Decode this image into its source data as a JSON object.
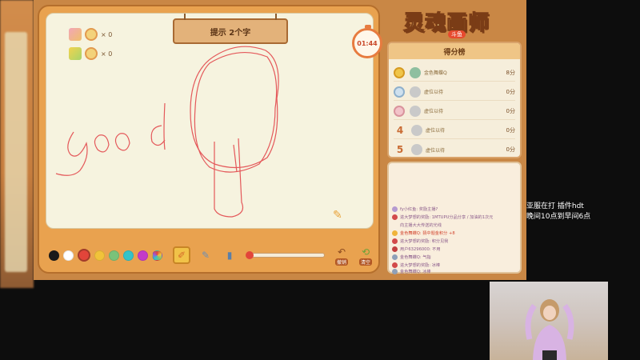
{
  "game": {
    "hint": "提示 2个字",
    "timer": "01:44",
    "props": [
      {
        "icon": "flower-icon",
        "count": "× 0"
      },
      {
        "icon": "egg-icon",
        "count": "× 0"
      }
    ],
    "drawing": {
      "word_written": "good"
    },
    "palette": [
      "#1a1a1a",
      "#ffffff",
      "#e2453a",
      "#f1c33a",
      "#7ac27a",
      "#35c3c8",
      "#c33bc9",
      "#9a5ad6"
    ],
    "tools": {
      "brush": "brush-icon",
      "eraser": "eraser-icon",
      "bucket": "bucket-icon"
    },
    "actions": {
      "undo": "撤销",
      "clear": "清空"
    }
  },
  "logo": {
    "title": "灵魂画师",
    "sub": "斗鱼"
  },
  "leaderboard": {
    "title": "得分榜",
    "rows": [
      {
        "rank": "",
        "name": "金色舞蝶Q",
        "score": "8分"
      },
      {
        "rank": "",
        "name": "虚位以待",
        "score": "0分"
      },
      {
        "rank": "",
        "name": "虚位以待",
        "score": "0分"
      },
      {
        "rank": "4",
        "name": "虚位以待",
        "score": "0分"
      },
      {
        "rank": "5",
        "name": "虚位以待",
        "score": "0分"
      }
    ]
  },
  "chat": [
    {
      "text": "fy小红鱼: 奖励主播?"
    },
    {
      "text": "进大梦想的奖励: 1MTUPU分品分享 / 加油的1次元"
    },
    {
      "text": "向主播大大传送的光线"
    },
    {
      "text": "金色舞蝶Q: 猜中题金积分 +8"
    },
    {
      "text": "进大梦想的奖励: 积分见我"
    },
    {
      "text": "用户63296000: 不用"
    },
    {
      "text": "金色舞蝶Q: 气指"
    },
    {
      "text": "进大梦想的奖励: 冰棒"
    },
    {
      "text": "金色舞蝶Q: 冰棒"
    }
  ],
  "overlay": {
    "line1": "亚服在打 插件hdt",
    "line2": "晚间10点到早间6点"
  }
}
